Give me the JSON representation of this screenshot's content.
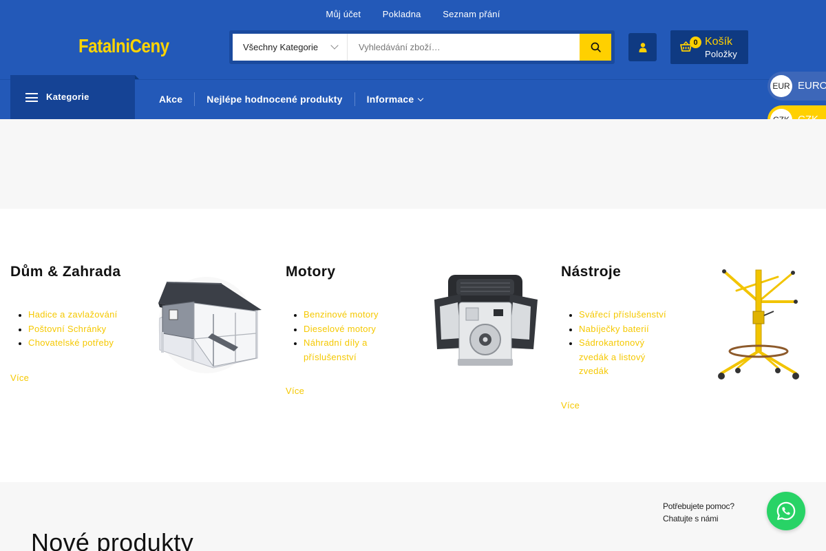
{
  "top_links": [
    "Můj účet",
    "Pokladna",
    "Seznam přání"
  ],
  "logo": "FatalniCeny",
  "search": {
    "category": "Všechny Kategorie",
    "placeholder": "Vyhledávání zboží…"
  },
  "cart": {
    "count": "0",
    "title": "Košík",
    "subtitle": "Položky"
  },
  "nav": {
    "categories_label": "Kategorie",
    "items": [
      "Akce",
      "Nejlépe hodnocené produkty",
      "Informace"
    ]
  },
  "currency": {
    "eur_code": "EUR",
    "eur_name": "EURO",
    "czk_code": "CZK",
    "czk_name": "CZK"
  },
  "categories": [
    {
      "title": "Dům & Zahrada",
      "items": [
        "Hadice a zavlažování",
        "Poštovní Schránky",
        "Chovatelské potřeby"
      ],
      "more": "Více"
    },
    {
      "title": "Motory",
      "items": [
        "Benzinové motory",
        "Dieselové motory",
        "Náhradní díly a příslušenství"
      ],
      "more": "Více"
    },
    {
      "title": "Nástroje",
      "items": [
        "Svářecí příslušenství",
        "Nabíječky baterií",
        "Sádrokartonový zvedák a listový zvedák"
      ],
      "more": "Více"
    }
  ],
  "new_products_title": "Nové produkty",
  "help": {
    "line1": "Potřebujete pomoc?",
    "line2": "Chatujte s námi"
  },
  "colors": {
    "header_blue": "#2359b8",
    "dark_blue": "#0f3a82",
    "accent_yellow": "#ffd000",
    "whatsapp_green": "#28d366"
  }
}
